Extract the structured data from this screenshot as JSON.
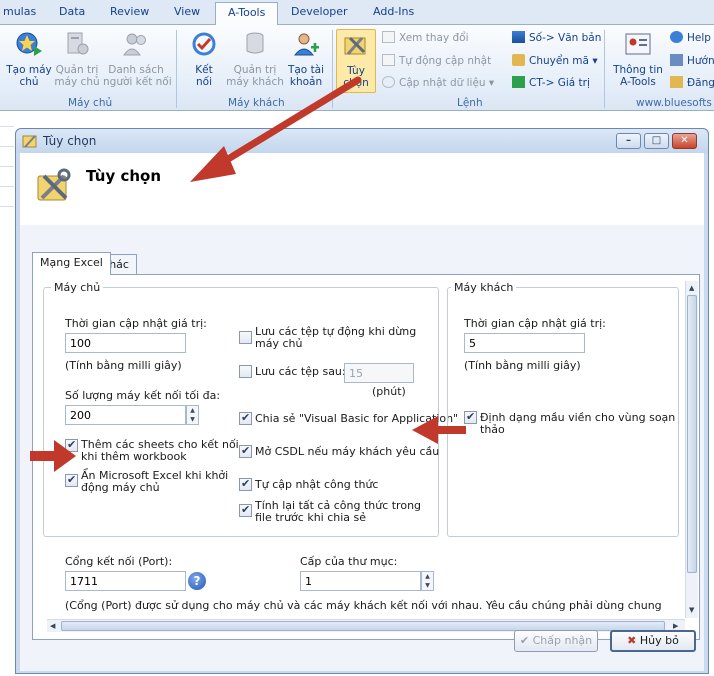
{
  "ribbon": {
    "tabs": [
      "mulas",
      "Data",
      "Review",
      "View",
      "A-Tools",
      "Developer",
      "Add-Ins"
    ],
    "active_tab": "A-Tools",
    "buttons": {
      "server": "Tạo máy\nchủ",
      "manage_server": "Quản trị\nmáy chủ",
      "client_list": "Danh sách\nngười kết nối",
      "connect": "Kết\nnối",
      "manage_client": "Quản trị\nmáy khách",
      "create_account": "Tạo tài\nkhoản",
      "options": "Tùy\nchọn",
      "info": "Thông tin\nA-Tools"
    },
    "small_buttons": {
      "view_changes": "Xem thay đổi",
      "auto_update": "Tự động cập nhật",
      "update_data": "Cập nhật dữ liệu",
      "num_to_text": "Số-> Văn bản",
      "convert": "Chuyển mã",
      "formula_to_value": "CT-> Giá trị",
      "help": "Help",
      "guide": "Hướn",
      "register": "Đăng"
    },
    "groups": {
      "server": "Máy chủ",
      "client": "Máy khách",
      "command": "Lệnh",
      "website": "www.bluesofts"
    }
  },
  "dialog": {
    "title": "Tùy chọn",
    "header": "Tùy chọn",
    "tabs": [
      "Mạng Excel",
      "Khác"
    ],
    "server_group": {
      "title": "Máy chủ",
      "update_label": "Thời gian cập nhật giá trị:",
      "update_value": "100",
      "update_unit": "(Tính bằng milli giây)",
      "max_label": "Số lượng máy kết nối tối đa:",
      "max_value": "200",
      "add_sheets": "Thêm các sheets cho kết nối khi thêm workbook",
      "hide_excel": "Ẩn Microsoft Excel khi khởi động máy chủ",
      "save_auto": "Lưu các tệp tự động khi dừng máy chủ",
      "save_after": "Lưu các tệp sau:",
      "save_after_value": "15",
      "minutes": "(phút)",
      "share_vba": "Chia sẻ \"Visual Basic for Application\"",
      "open_db": "Mở CSDL nếu máy khách yêu cầu",
      "auto_formula": "Tự cập nhật công thức",
      "recalc": "Tính lại tất cả công thức trong file trước khi chia sẻ"
    },
    "client_group": {
      "title": "Máy khách",
      "update_label": "Thời gian cập nhật giá trị:",
      "update_value": "5",
      "update_unit": "(Tính bằng milli giây)",
      "border_format": "Định dạng mầu viền cho vùng soạn thảo"
    },
    "port_label": "Cổng kết nối (Port):",
    "port_value": "1711",
    "folder_label": "Cấp của thư mục:",
    "folder_value": "1",
    "note": "(Cổng (Port) được sử dụng cho máy chủ và các máy khách kết nối với nhau. Yêu cầu chúng phải dùng chung",
    "accept": "Chấp nhận",
    "cancel": "Hủy bỏ"
  },
  "colors": {
    "arrow": "#c0392b",
    "ribbon_text": "#15428b"
  }
}
